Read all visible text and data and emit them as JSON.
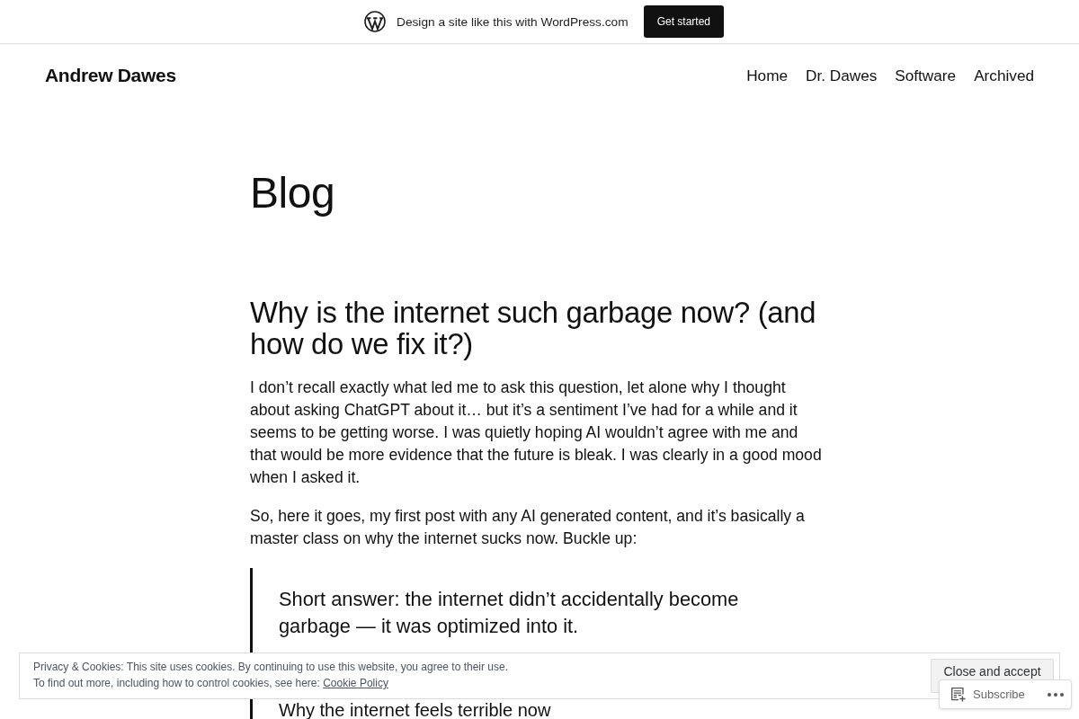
{
  "top_bar": {
    "text": "Design a site like this with WordPress.com",
    "button": "Get started"
  },
  "header": {
    "site_title": "Andrew Dawes",
    "nav": [
      {
        "label": "Home"
      },
      {
        "label": "Dr. Dawes"
      },
      {
        "label": "Software"
      },
      {
        "label": "Archived"
      }
    ]
  },
  "page_title": "Blog",
  "post": {
    "title": "Why is the internet such garbage now? (and how do we fix it?)",
    "paragraphs": [
      "I don’t recall exactly what led me to ask this question, let alone why I thought about asking ChatGPT about it… but it’s a sentiment I’ve had for a while and it seems to be getting worse. I was quietly hoping AI wouldn’t agree with me and that would be more evidence that the future is bleak. I was clearly in a good mood when I asked it.",
      "So, here it goes, my first post with any AI generated content, and it’s basically a master class on why the internet sucks now. Buckle up:"
    ],
    "blockquote": {
      "text": "Short answer: the internet didn’t accidentally become garbage — it was optimized into it.",
      "subheading": "Why the internet feels terrible now"
    }
  },
  "cookie_banner": {
    "line_1": "Privacy & Cookies: This site uses cookies. By continuing to use this website, you agree to their use.",
    "line_2": "To find out more, including how to control cookies, see here:",
    "link": "Cookie Policy",
    "button": "Close and accept"
  },
  "subscribe_bar": {
    "label": "Subscribe"
  }
}
